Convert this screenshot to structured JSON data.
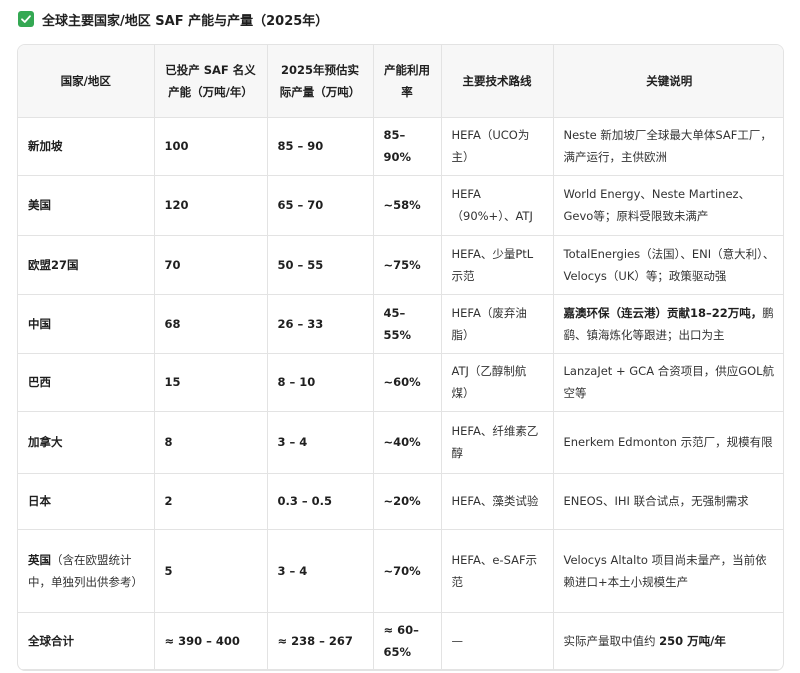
{
  "title": "全球主要国家/地区 SAF 产能与产量（2025年）",
  "headers": [
    "国家/地区",
    "已投产 SAF 名义产能（万吨/年）",
    "2025年预估实际产量（万吨）",
    "产能利用率",
    "主要技术路线",
    "关键说明"
  ],
  "rows": [
    {
      "region": "新加坡",
      "note": "",
      "capacity": "100",
      "output": "85 – 90",
      "utilization": "85–90%",
      "tech": "HEFA（UCO为主）",
      "desc_bold": "",
      "desc": "Neste 新加坡厂全球最大单体SAF工厂，满产运行，主供欧洲"
    },
    {
      "region": "美国",
      "note": "",
      "capacity": "120",
      "output": "65 – 70",
      "utilization": "~58%",
      "tech": "HEFA（90%+）、ATJ",
      "desc_bold": "",
      "desc": "World Energy、Neste Martinez、Gevo等；原料受限致未满产"
    },
    {
      "region": "欧盟27国",
      "note": "",
      "capacity": "70",
      "output": "50 – 55",
      "utilization": "~75%",
      "tech": "HEFA、少量PtL示范",
      "desc_bold": "",
      "desc": "TotalEnergies（法国）、ENI（意大利）、Velocys（UK）等；政策驱动强"
    },
    {
      "region": "中国",
      "note": "",
      "capacity": "68",
      "output": "26 – 33",
      "utilization": "45–55%",
      "tech": "HEFA（废弃油脂）",
      "desc_bold": "嘉澳环保（连云港）贡献18–22万吨，",
      "desc": "鹏鹞、镇海炼化等跟进；出口为主"
    },
    {
      "region": "巴西",
      "note": "",
      "capacity": "15",
      "output": "8 – 10",
      "utilization": "~60%",
      "tech": "ATJ（乙醇制航煤）",
      "desc_bold": "",
      "desc": "LanzaJet + GCA 合资项目，供应GOL航空等"
    },
    {
      "region": "加拿大",
      "note": "",
      "capacity": "8",
      "output": "3 – 4",
      "utilization": "~40%",
      "tech": "HEFA、纤维素乙醇",
      "desc_bold": "",
      "desc": "Enerkem Edmonton 示范厂，规模有限"
    },
    {
      "region": "日本",
      "note": "",
      "capacity": "2",
      "output": "0.3 – 0.5",
      "utilization": "~20%",
      "tech": "HEFA、藻类试验",
      "desc_bold": "",
      "desc": "ENEOS、IHI 联合试点，无强制需求"
    },
    {
      "region": "英国",
      "note": "（含在欧盟统计中，单独列出供参考）",
      "capacity": "5",
      "output": "3 – 4",
      "utilization": "~70%",
      "tech": "HEFA、e-SAF示范",
      "desc_bold": "",
      "desc": "Velocys Altalto 项目尚未量产，当前依赖进口+本土小规模生产"
    },
    {
      "region": "全球合计",
      "note": "",
      "capacity": "≈ 390 – 400",
      "output": "≈ 238 – 267",
      "utilization": "≈ 60–65%",
      "tech": "—",
      "desc_pre": "实际产量取中值约 ",
      "desc_bold": "250 万吨/年",
      "desc": ""
    }
  ]
}
